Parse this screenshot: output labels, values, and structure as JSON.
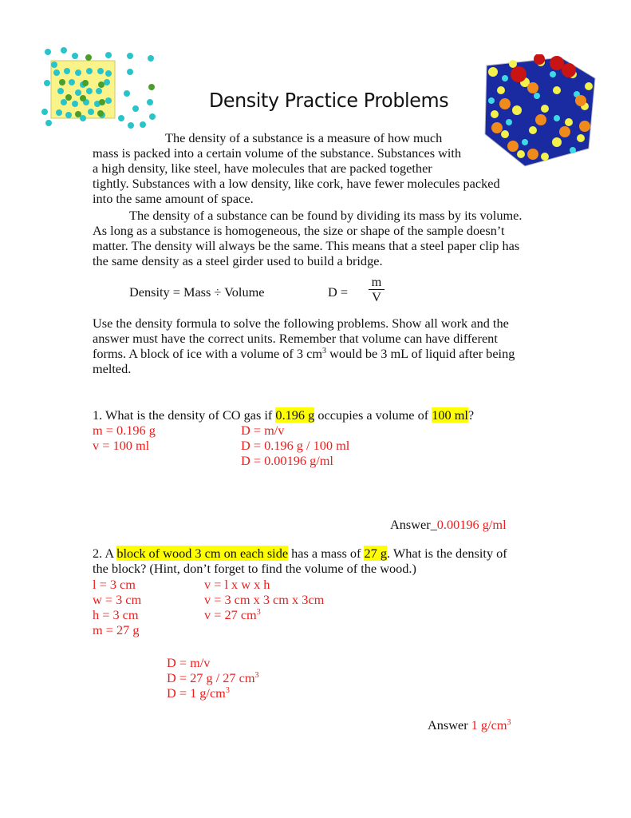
{
  "title": "Density Practice Problems",
  "images": {
    "left": "molecules-low-density-illustration",
    "right": "molecules-high-density-cube-illustration"
  },
  "intro": {
    "lines": [
      "The density of a substance is a measure of how much",
      "mass is packed into a certain volume of the substance. Substances with",
      "a high density, like steel, have molecules that are packed together",
      "tightly. Substances with a low density, like cork, have fewer molecules packed",
      "into the same amount of space.",
      "The density of a substance can be found by dividing its mass by its volume.",
      "As long as a substance is homogeneous, the size or shape of the sample doesn’t",
      "matter. The density will always be the same. This means that a steel paper clip has",
      "the same density as a steel girder used to build a bridge."
    ]
  },
  "formula": {
    "words": "Density = Mass ÷ Volume",
    "lhs": "D =",
    "numerator": "m",
    "denominator": "V"
  },
  "instructions": {
    "line1": "Use the density formula to solve the following problems. Show all work and the",
    "line2": "answer must have the correct units. Remember that volume can have different",
    "line3_a": "forms. A block of ice with a volume of 3 cm",
    "line3_sup": "3",
    "line3_b": " would be 3 mL of liquid after being",
    "line4": "melted."
  },
  "problem1": {
    "q_a": "1. What is the density of CO gas if ",
    "q_hl1": "0.196 g",
    "q_b": " occupies a volume of ",
    "q_hl2": "100 ml",
    "q_c": "?",
    "work_left": [
      "m = 0.196 g",
      "v = 100 ml"
    ],
    "work_right": [
      "D = m/v",
      "D = 0.196 g / 100 ml",
      "D = 0.00196  g/ml"
    ],
    "answer_label": "Answer_",
    "answer_value": "0.00196 g/ml"
  },
  "problem2": {
    "q_a": "2. A ",
    "q_hl1": "block of wood 3 cm on each side",
    "q_b": " has a mass of ",
    "q_hl2": "27 g",
    "q_c": ". What is the density of",
    "q_line2": "the block? (Hint, don’t forget to find the volume of the wood.)",
    "work_left": [
      "l = 3 cm",
      "w = 3 cm",
      "h = 3 cm",
      "m = 27 g"
    ],
    "work_right": [
      "v = l x w x h",
      "v = 3 cm x 3 cm x 3cm",
      "v = 27 cm"
    ],
    "work_right_sup": "3",
    "density_lines": [
      "D = m/v",
      "D = 27 g / 27 cm",
      "D = 1 g/cm"
    ],
    "density_sup": "3",
    "answer_label": "Answer ",
    "answer_value": "1 g/cm",
    "answer_sup": "3"
  }
}
